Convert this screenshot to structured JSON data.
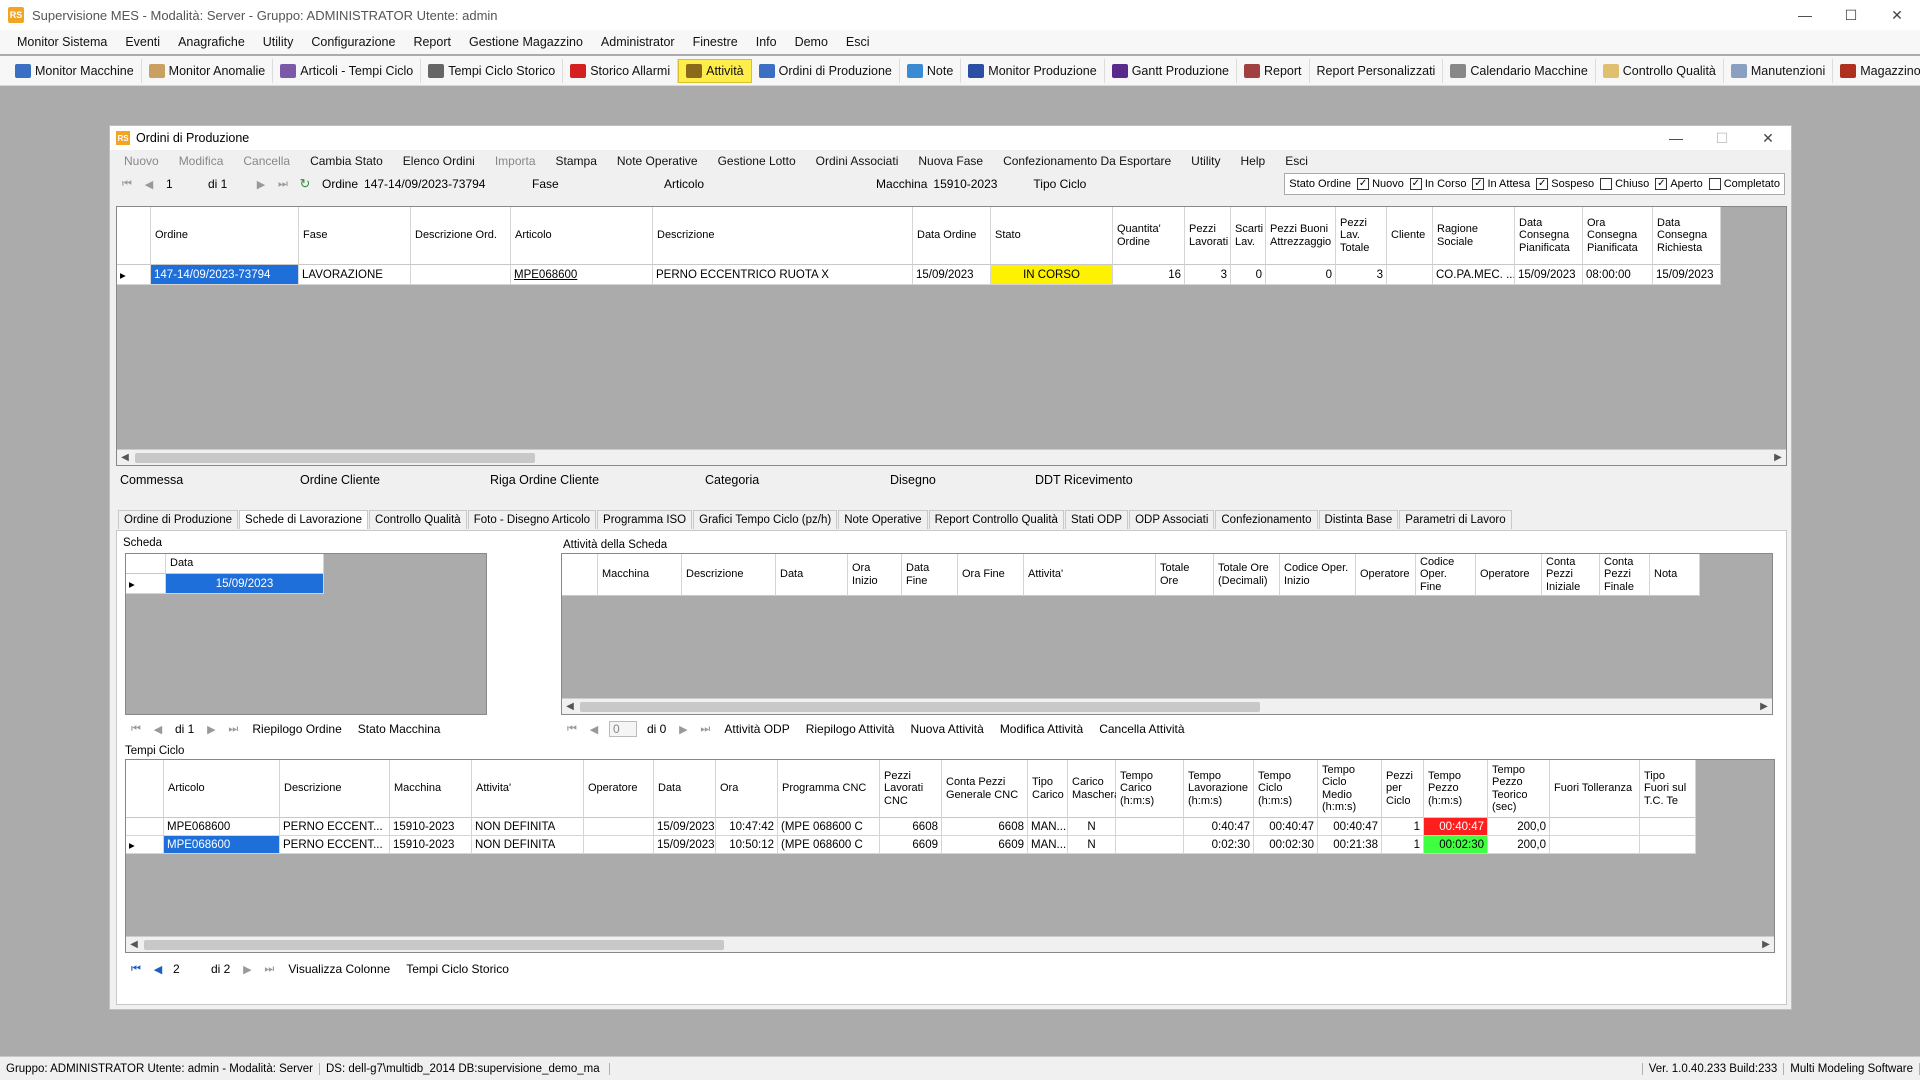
{
  "app": {
    "title": "Supervisione MES  -  Modalità: Server  -  Gruppo: ADMINISTRATOR  Utente: admin",
    "logo": "RS"
  },
  "menu": [
    "Monitor Sistema",
    "Eventi",
    "Anagrafiche",
    "Utility",
    "Configurazione",
    "Report",
    "Gestione Magazzino",
    "Administrator",
    "Finestre",
    "Info",
    "Demo",
    "Esci"
  ],
  "toolbar": [
    {
      "label": "Monitor Macchine",
      "icon": "monitor-icon",
      "color": "#3a6fc4"
    },
    {
      "label": "Monitor Anomalie",
      "icon": "hand-icon",
      "color": "#c9a060"
    },
    {
      "label": "Articoli - Tempi Ciclo",
      "icon": "parts-icon",
      "color": "#7a5aa8"
    },
    {
      "label": "Tempi Ciclo Storico",
      "icon": "clock-icon",
      "color": "#666666"
    },
    {
      "label": "Storico Allarmi",
      "icon": "alarm-icon",
      "color": "#d42020"
    },
    {
      "label": "Attività",
      "icon": "gears-icon",
      "color": "#8a6a1a"
    },
    {
      "label": "Ordini di Produzione",
      "icon": "orders-icon",
      "color": "#3a6fc4"
    },
    {
      "label": "Note",
      "icon": "note-icon",
      "color": "#3a8ad4"
    },
    {
      "label": "Monitor Produzione",
      "icon": "screen-icon",
      "color": "#2a4fa4"
    },
    {
      "label": "Gantt Produzione",
      "icon": "gantt-icon",
      "color": "#5a2a8a"
    },
    {
      "label": "Report",
      "icon": "report-icon",
      "color": "#a04040"
    },
    {
      "label": "Report Personalizzati",
      "icon": "",
      "color": ""
    },
    {
      "label": "Calendario Macchine",
      "icon": "calendar-icon",
      "color": "#888888"
    },
    {
      "label": "Controllo Qualità",
      "icon": "doc-icon",
      "color": "#e0c070"
    },
    {
      "label": "Manutenzioni",
      "icon": "wrench-icon",
      "color": "#8aa0c0"
    },
    {
      "label": "Magazzino",
      "icon": "box-icon",
      "color": "#b03020"
    }
  ],
  "toolbar_active": "Attività",
  "inner": {
    "title": "Ordini di Produzione",
    "menu": [
      {
        "label": "Nuovo",
        "disabled": true
      },
      {
        "label": "Modifica",
        "disabled": true
      },
      {
        "label": "Cancella",
        "disabled": true
      },
      {
        "label": "Cambia Stato",
        "disabled": false
      },
      {
        "label": "Elenco Ordini",
        "disabled": false
      },
      {
        "label": "Importa",
        "disabled": true
      },
      {
        "label": "Stampa",
        "disabled": false
      },
      {
        "label": "Note Operative",
        "disabled": false
      },
      {
        "label": "Gestione Lotto",
        "disabled": false
      },
      {
        "label": "Ordini Associati",
        "disabled": false
      },
      {
        "label": "Nuova Fase",
        "disabled": false
      },
      {
        "label": "Confezionamento Da Esportare",
        "disabled": false
      },
      {
        "label": "Utility",
        "disabled": false
      },
      {
        "label": "Help",
        "disabled": false
      },
      {
        "label": "Esci",
        "disabled": false
      }
    ],
    "nav": {
      "page": "1",
      "of": "di 1",
      "ordine_label": "Ordine",
      "ordine_value": "147-14/09/2023-73794",
      "fase_label": "Fase",
      "articolo_label": "Articolo",
      "macchina_label": "Macchina",
      "macchina_value": "15910-2023",
      "tipo_ciclo_label": "Tipo Ciclo"
    },
    "stato_ordine": {
      "label": "Stato Ordine",
      "items": [
        {
          "label": "Nuovo",
          "checked": true
        },
        {
          "label": "In Corso",
          "checked": true
        },
        {
          "label": "In Attesa",
          "checked": true
        },
        {
          "label": "Sospeso",
          "checked": true
        },
        {
          "label": "Chiuso",
          "checked": false
        },
        {
          "label": "Aperto",
          "checked": true
        },
        {
          "label": "Completato",
          "checked": false
        }
      ]
    },
    "orders_grid": {
      "headers": [
        "Ordine",
        "Fase",
        "Descrizione Ord.",
        "Articolo",
        "Descrizione",
        "Data Ordine",
        "Stato",
        "Quantita' Ordine",
        "Pezzi Lavorati",
        "Scarti Lav.",
        "Pezzi Buoni Attrezzaggio",
        "Pezzi Lav. Totale",
        "Cliente",
        "Ragione Sociale",
        "Data Consegna Pianificata",
        "Ora Consegna Pianificata",
        "Data Consegna Richiesta"
      ],
      "rows": [
        [
          "147-14/09/2023-73794",
          "LAVORAZIONE",
          "",
          "MPE068600",
          "PERNO ECCENTRICO RUOTA X",
          "15/09/2023",
          "IN CORSO",
          "16",
          "3",
          "0",
          "0",
          "3",
          "",
          "CO.PA.MEC. ...",
          "15/09/2023",
          "08:00:00",
          "15/09/2023"
        ]
      ]
    },
    "fields": [
      "Commessa",
      "Ordine Cliente",
      "Riga Ordine Cliente",
      "Categoria",
      "Disegno",
      "DDT Ricevimento"
    ],
    "tabs": [
      "Ordine di Produzione",
      "Schede di Lavorazione",
      "Controllo Qualità",
      "Foto - Disegno Articolo",
      "Programma ISO",
      "Grafici Tempo Ciclo (pz/h)",
      "Note Operative",
      "Report Controllo Qualità",
      "Stati ODP",
      "ODP Associati",
      "Confezionamento",
      "Distinta Base",
      "Parametri di Lavoro"
    ],
    "active_tab": "Schede di Lavorazione",
    "scheda": {
      "caption": "Scheda",
      "header": "Data",
      "rows": [
        "15/09/2023"
      ],
      "nav_of": "di 1",
      "buttons": [
        "Riepilogo Ordine",
        "Stato Macchina"
      ]
    },
    "attivita": {
      "caption": "Attività della Scheda",
      "headers": [
        "Macchina",
        "Descrizione",
        "Data",
        "Ora Inizio",
        "Data Fine",
        "Ora Fine",
        "Attivita'",
        "Totale Ore",
        "Totale Ore (Decimali)",
        "Codice Oper. Inizio",
        "Operatore",
        "Codice Oper. Fine",
        "Operatore",
        "Conta Pezzi Iniziale",
        "Conta Pezzi Finale",
        "Nota"
      ],
      "nav_value": "0",
      "nav_of": "di 0",
      "buttons": [
        "Attività ODP",
        "Riepilogo Attività",
        "Nuova Attività",
        "Modifica Attività",
        "Cancella Attività"
      ]
    },
    "tempi": {
      "caption": "Tempi Ciclo",
      "headers": [
        "Articolo",
        "Descrizione",
        "Macchina",
        "Attivita'",
        "Operatore",
        "Data",
        "Ora",
        "Programma CNC",
        "Pezzi Lavorati CNC",
        "Conta Pezzi Generale CNC",
        "Tipo Carico",
        "Carico Maschera",
        "Tempo Carico (h:m:s)",
        "Tempo Lavorazione (h:m:s)",
        "Tempo Ciclo (h:m:s)",
        "Tempo Ciclo Medio (h:m:s)",
        "Pezzi per Ciclo",
        "Tempo Pezzo (h:m:s)",
        "Tempo Pezzo Teorico (sec)",
        "Fuori Tolleranza",
        "Tipo Fuori sul T.C. Te"
      ],
      "rows": [
        [
          "MPE068600",
          "PERNO ECCENT...",
          "15910-2023",
          "NON DEFINITA",
          "",
          "15/09/2023",
          "10:47:42",
          "(MPE 068600 C",
          "6608",
          "6608",
          "MAN...",
          "N",
          "",
          "0:40:47",
          "00:40:47",
          "00:40:47",
          "1",
          "00:40:47",
          "200,0",
          "",
          ""
        ],
        [
          "MPE068600",
          "PERNO ECCENT...",
          "15910-2023",
          "NON DEFINITA",
          "",
          "15/09/2023",
          "10:50:12",
          "(MPE 068600 C",
          "6609",
          "6609",
          "MAN...",
          "N",
          "",
          "0:02:30",
          "00:02:30",
          "00:21:38",
          "1",
          "00:02:30",
          "200,0",
          "",
          ""
        ]
      ],
      "nav_value": "2",
      "nav_of": "di 2",
      "buttons": [
        "Visualizza Colonne",
        "Tempi Ciclo Storico"
      ]
    }
  },
  "status": [
    "Gruppo: ADMINISTRATOR  Utente: admin  -  Modalità: Server",
    "DS: dell-g7\\multidb_2014 DB:supervisione_demo_ma",
    "Ver. 1.0.40.233 Build:233",
    "Multi Modeling Software"
  ],
  "colors": {
    "accent": "#1e6fd9",
    "in_corso": "#fff200",
    "alert": "#ff1e1e",
    "ok": "#40ff40",
    "active_tool": "#ffee4a"
  }
}
